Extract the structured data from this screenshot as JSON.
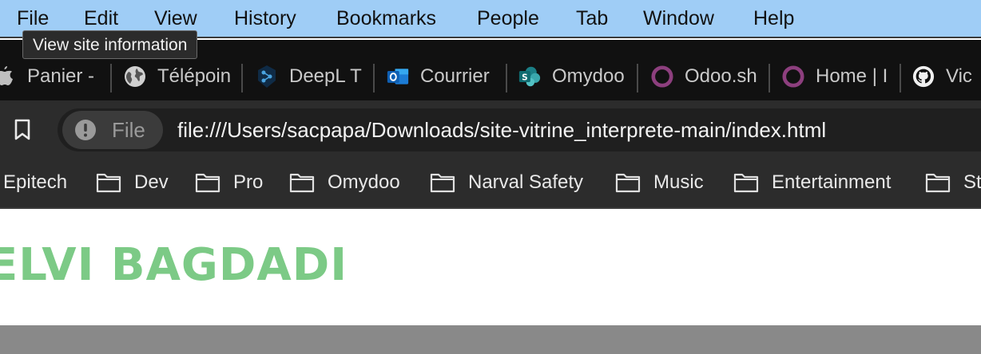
{
  "menubar": {
    "apple_icon": "apple-icon",
    "items": [
      "File",
      "Edit",
      "View",
      "History",
      "Bookmarks",
      "People",
      "Tab",
      "Window",
      "Help"
    ]
  },
  "tooltip": {
    "text": "View site information"
  },
  "tabs": [
    {
      "label": "Panier -",
      "icon": "apple-icon"
    },
    {
      "label": "Télépoin",
      "icon": "globe-icon"
    },
    {
      "label": "DeepL T",
      "icon": "deepl-icon"
    },
    {
      "label": "Courrier",
      "icon": "outlook-icon"
    },
    {
      "label": "Omydoo",
      "icon": "sharepoint-icon"
    },
    {
      "label": "Odoo.sh",
      "icon": "odoo-icon"
    },
    {
      "label": "Home | I",
      "icon": "odoo-icon"
    },
    {
      "label": "Vic",
      "icon": "github-icon"
    }
  ],
  "toolbar": {
    "bookmark_icon": "bookmark-icon",
    "chip_label": "File",
    "url": "file:///Users/sacpapa/Downloads/site-vitrine_interprete-main/index.html"
  },
  "bookmarks": [
    {
      "label": "Epitech"
    },
    {
      "label": "Dev"
    },
    {
      "label": "Pro"
    },
    {
      "label": "Omydoo"
    },
    {
      "label": "Narval Safety"
    },
    {
      "label": "Music"
    },
    {
      "label": "Entertainment"
    },
    {
      "label": "St"
    }
  ],
  "page": {
    "hero_name": "ELVI BAGDADI",
    "accent_color": "#7cca86"
  },
  "colors": {
    "menubar_bg": "#9fcdf6",
    "tabstrip_bg": "#111111",
    "toolbar_bg": "#2c2c2c",
    "footer_band": "#898989"
  }
}
